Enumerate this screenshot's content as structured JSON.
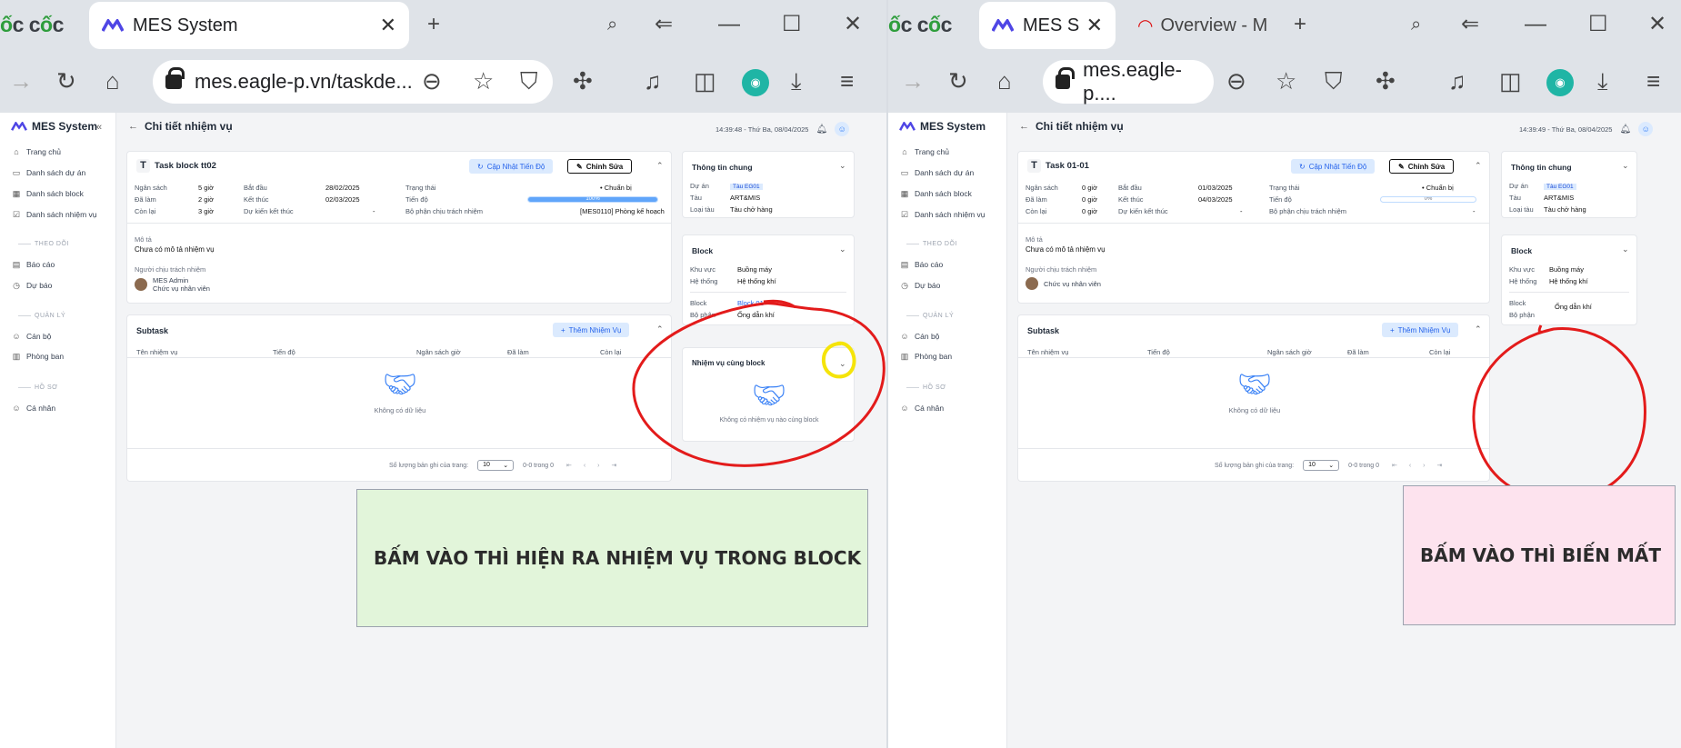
{
  "browser": {
    "logo": "ốc cốc",
    "left_tab_title": "MES System",
    "right_tab_title": "MES System",
    "right_tab2_title": "Overview - Mi",
    "left_url": "mes.eagle-p.vn/taskde...",
    "right_url": "mes.eagle-p...."
  },
  "app": {
    "brand": "MES System",
    "nav": {
      "home": "Trang chủ",
      "projects": "Danh sách dự án",
      "blocks": "Danh sách block",
      "tasks": "Danh sách nhiệm vụ",
      "sec_follow": "THEO DÕI",
      "reports": "Báo cáo",
      "forecast": "Dự báo",
      "sec_manage": "QUẢN LÝ",
      "staff": "Cán bộ",
      "departments": "Phòng ban",
      "sec_profile": "HỒ SƠ",
      "personal": "Cá nhân"
    },
    "page_title": "Chi tiết nhiệm vụ"
  },
  "labels": {
    "budget": "Ngân sách",
    "done": "Đã làm",
    "remaining": "Còn lại",
    "start": "Bắt đầu",
    "end": "Kết thúc",
    "expected_end": "Dự kiến kết thúc",
    "status": "Trạng thái",
    "progress": "Tiến độ",
    "dept": "Bộ phận chịu trách nhiệm",
    "desc": "Mô tả",
    "desc_val": "Chưa có mô tả nhiệm vụ",
    "owner": "Người chịu trách nhiệm",
    "update_btn": "Cập Nhật Tiến Độ",
    "edit_btn": "Chỉnh Sửa",
    "subtask": "Subtask",
    "add_task": "Thêm Nhiệm Vụ",
    "col_name": "Tên nhiệm vụ",
    "col_progress": "Tiến độ",
    "col_budget": "Ngân sách giờ",
    "col_done": "Đã làm",
    "col_remaining": "Còn lại",
    "no_data": "Không có dữ liệu",
    "rows_per_page": "Số lượng bản ghi của trang:",
    "rows_value": "10",
    "range": "0-0 trong 0",
    "general_info": "Thông tin chung",
    "project": "Dự án",
    "ship": "Tàu",
    "ship_type": "Loại tàu",
    "block": "Block",
    "area": "Khu vực",
    "system": "Hệ thống",
    "block_label": "Block",
    "part": "Bộ phận",
    "same_block": "Nhiệm vụ cùng block",
    "no_same_block": "Không có nhiệm vụ nào cùng block"
  },
  "left": {
    "timestamp": "14:39:48 - Thứ Ba, 08/04/2025",
    "task_name": "Task block tt02",
    "budget": "5 giờ",
    "done": "2 giờ",
    "remaining": "3 giờ",
    "start": "28/02/2025",
    "end": "02/03/2025",
    "expected_end": "-",
    "status": "Chuẩn bị",
    "progress_text": "100%",
    "progress_value": 1.0,
    "dept": "[MES0110] Phòng kế hoạch",
    "owner_name": "MES Admin",
    "owner_role": "Chức vụ nhân viên",
    "project": "Tàu EG01",
    "ship": "ART&MIS",
    "ship_type": "Tàu chở hàng",
    "area": "Buồng máy",
    "system": "Hệ thống khí",
    "block": "Block 01",
    "part": "Ống dẫn khí",
    "note": "BẤM VÀO THÌ HIỆN RA NHIỆM VỤ TRONG BLOCK",
    "note_color": "#e2f5da"
  },
  "right": {
    "timestamp": "14:39:49 - Thứ Ba, 08/04/2025",
    "task_name": "Task 01-01",
    "budget": "0 giờ",
    "done": "0 giờ",
    "remaining": "0 giờ",
    "start": "01/03/2025",
    "end": "04/03/2025",
    "expected_end": "-",
    "status": "Chuẩn bị",
    "progress_text": "0%",
    "progress_value": 0.0,
    "dept": "-",
    "owner_role": "Chức vụ nhân viên",
    "project": "Tàu EG01",
    "ship": "ART&MIS",
    "ship_type": "Tàu chở hàng",
    "area": "Buồng máy",
    "system": "Hệ thống khí",
    "part": "Ống dẫn khí",
    "note": "BẤM VÀO THÌ BIẾN MẤT",
    "note_color": "#fde3ee"
  },
  "colors": {
    "accent": "#2563eb",
    "annotation_red": "#e31b1b",
    "annotation_yellow": "#f5e40a"
  }
}
